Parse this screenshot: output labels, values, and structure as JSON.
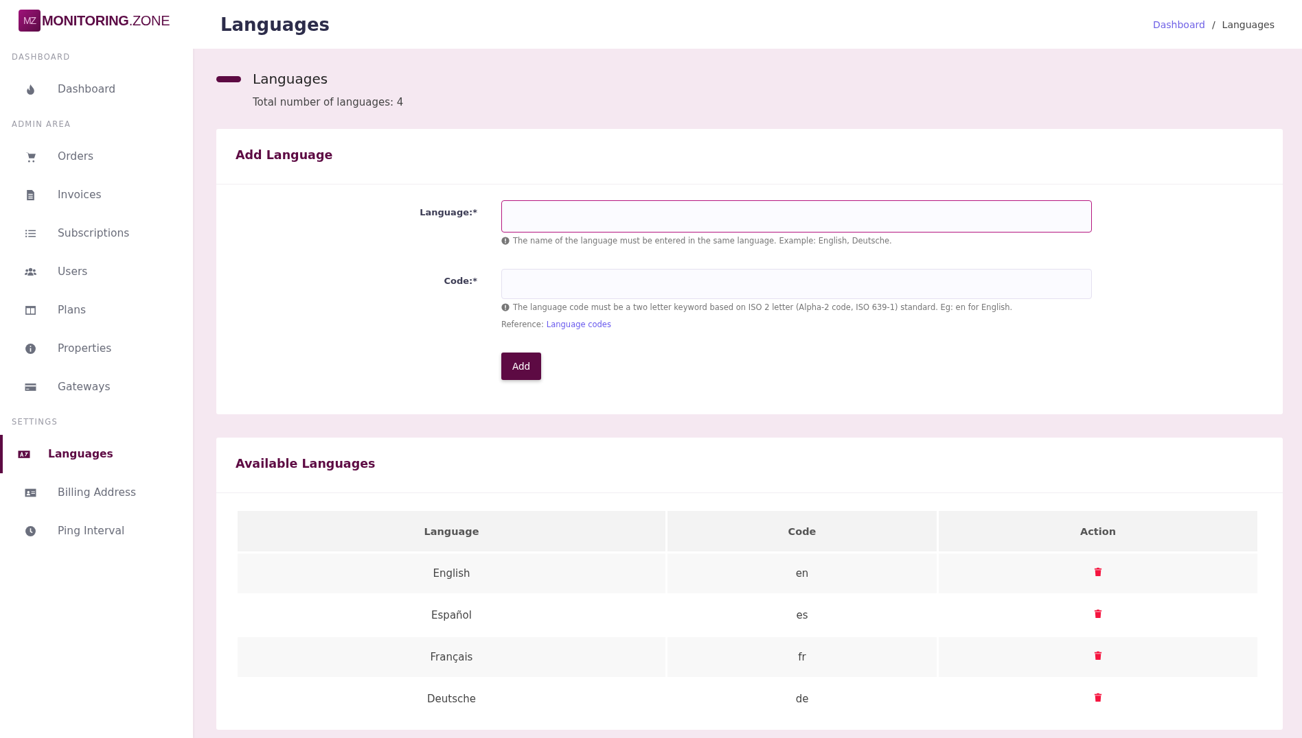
{
  "logo": {
    "badge": "MZ",
    "wordmark": "**MONITORING**.ZONE"
  },
  "sidebar": {
    "sections": [
      {
        "label": "DASHBOARD",
        "items": [
          {
            "label": "Dashboard",
            "selected": false
          }
        ]
      },
      {
        "label": "ADMIN AREA",
        "items": [
          {
            "label": "Orders",
            "selected": false
          },
          {
            "label": "Invoices",
            "selected": false
          },
          {
            "label": "Subscriptions",
            "selected": false
          },
          {
            "label": "Users",
            "selected": false
          },
          {
            "label": "Plans",
            "selected": false
          },
          {
            "label": "Properties",
            "selected": false
          },
          {
            "label": "Gateways",
            "selected": false
          }
        ]
      },
      {
        "label": "SETTINGS",
        "items": [
          {
            "label": "Languages",
            "selected": true
          },
          {
            "label": "Billing Address",
            "selected": false
          },
          {
            "label": "Ping Interval",
            "selected": false
          }
        ]
      }
    ]
  },
  "header": {
    "title": "Languages",
    "breadcrumb": [
      {
        "label": "Dashboard",
        "link": true
      },
      {
        "label": "/",
        "link": false
      },
      {
        "label": "Languages",
        "link": false
      }
    ]
  },
  "summary": {
    "title": "Languages",
    "subtitle": "Total number of languages: 4"
  },
  "add_form": {
    "title": "Add Language",
    "fields": [
      {
        "label": "Language:*",
        "focused": true,
        "hint": "The name of the language must be entered in the same language. Example: English, Deutsche."
      },
      {
        "label": "Code:*",
        "focused": false,
        "hint": "The language code must be a two letter keyword based on ISO 2 letter (Alpha-2 code, ISO 639-1) standard. Eg: en for English.",
        "reference_label": "Reference:",
        "reference_link": "Language codes"
      }
    ],
    "button": "Add"
  },
  "languages_table": {
    "title": "Available Languages",
    "columns": [
      "Language",
      "Code",
      "Action"
    ],
    "rows": [
      {
        "language": "English",
        "code": "en"
      },
      {
        "language": "Español",
        "code": "es"
      },
      {
        "language": "Français",
        "code": "fr"
      },
      {
        "language": "Deutsche",
        "code": "de"
      }
    ]
  }
}
